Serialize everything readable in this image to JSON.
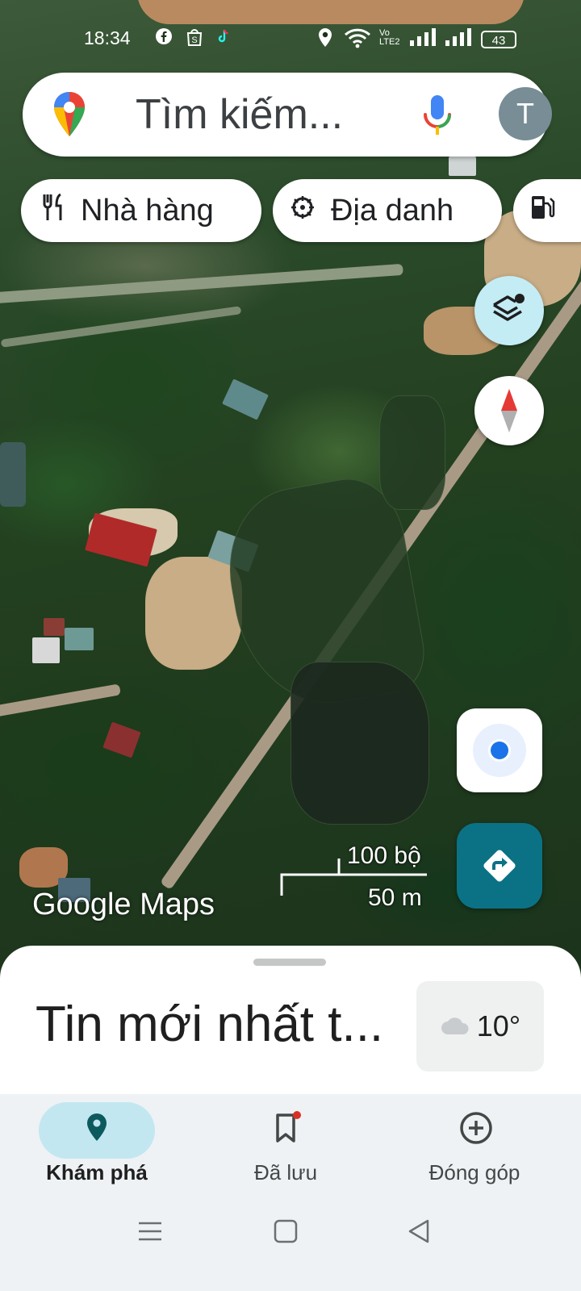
{
  "status_bar": {
    "time": "18:34",
    "lte_label": "Vo LTE2",
    "battery": "43"
  },
  "search": {
    "placeholder": "Tìm kiếm...",
    "avatar_letter": "T"
  },
  "chips": [
    {
      "label": "Nhà hàng",
      "icon": "fork-knife-icon"
    },
    {
      "label": "Địa danh",
      "icon": "landmark-icon"
    },
    {
      "label": "",
      "icon": "gas-station-icon"
    }
  ],
  "map": {
    "scale_feet": "100 bộ",
    "scale_meters": "50 m",
    "logo_text": "Google Maps"
  },
  "sheet": {
    "title": "Tin mới nhất t...",
    "weather_temp": "10°"
  },
  "nav": {
    "tabs": [
      {
        "label": "Khám phá",
        "active": true
      },
      {
        "label": "Đã lưu",
        "active": false,
        "badge": true
      },
      {
        "label": "Đóng góp",
        "active": false
      }
    ]
  },
  "colors": {
    "accent_teal": "#0b7285",
    "active_pill": "#c2e7f0",
    "location_blue": "#1a73e8",
    "nav_background": "#eef2f5"
  }
}
